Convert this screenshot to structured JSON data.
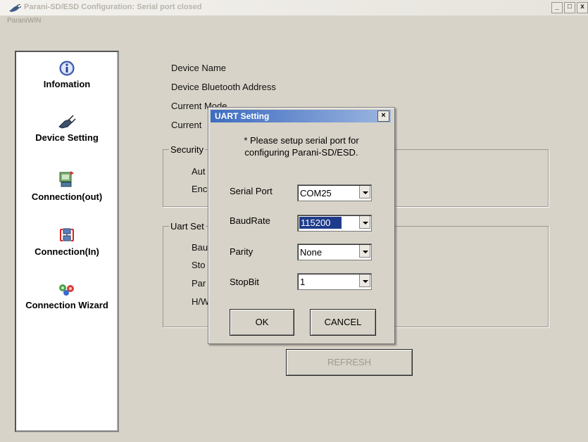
{
  "window": {
    "title": "Parani-SD/ESD Configuration: Serial port closed",
    "menu": "ParaniWIN",
    "controls": [
      "_",
      "□",
      "x"
    ]
  },
  "sidebar": {
    "items": [
      {
        "label": "Infomation",
        "icon": "info-icon"
      },
      {
        "label": "Device Setting",
        "icon": "device-plug-icon"
      },
      {
        "label": "Connection(out)",
        "icon": "connection-out-icon"
      },
      {
        "label": "Connection(In)",
        "icon": "connection-in-icon"
      },
      {
        "label": "Connection Wizard",
        "icon": "connection-wizard-icon"
      }
    ]
  },
  "main": {
    "device_name": "Device Name",
    "bt_address": "Device Bluetooth Address",
    "current_mode": "Current Mode",
    "current_2": "Current",
    "security_title": "Security",
    "security_auth": "Aut",
    "security_enc": "Enc",
    "uart_title": "Uart Set",
    "uart_baud": "Bau",
    "uart_stop": "Sto",
    "uart_parity": "Par",
    "uart_hw": "H/W",
    "refresh": "REFRESH"
  },
  "dialog": {
    "title": "UART Setting",
    "note_line1": "* Please setup serial port for",
    "note_line2": "configuring Parani-SD/ESD.",
    "serial_port_label": "Serial Port",
    "serial_port_value": "COM25",
    "baudrate_label": "BaudRate",
    "baudrate_value": "115200",
    "parity_label": "Parity",
    "parity_value": "None",
    "stopbit_label": "StopBit",
    "stopbit_value": "1",
    "ok": "OK",
    "cancel": "CANCEL"
  }
}
